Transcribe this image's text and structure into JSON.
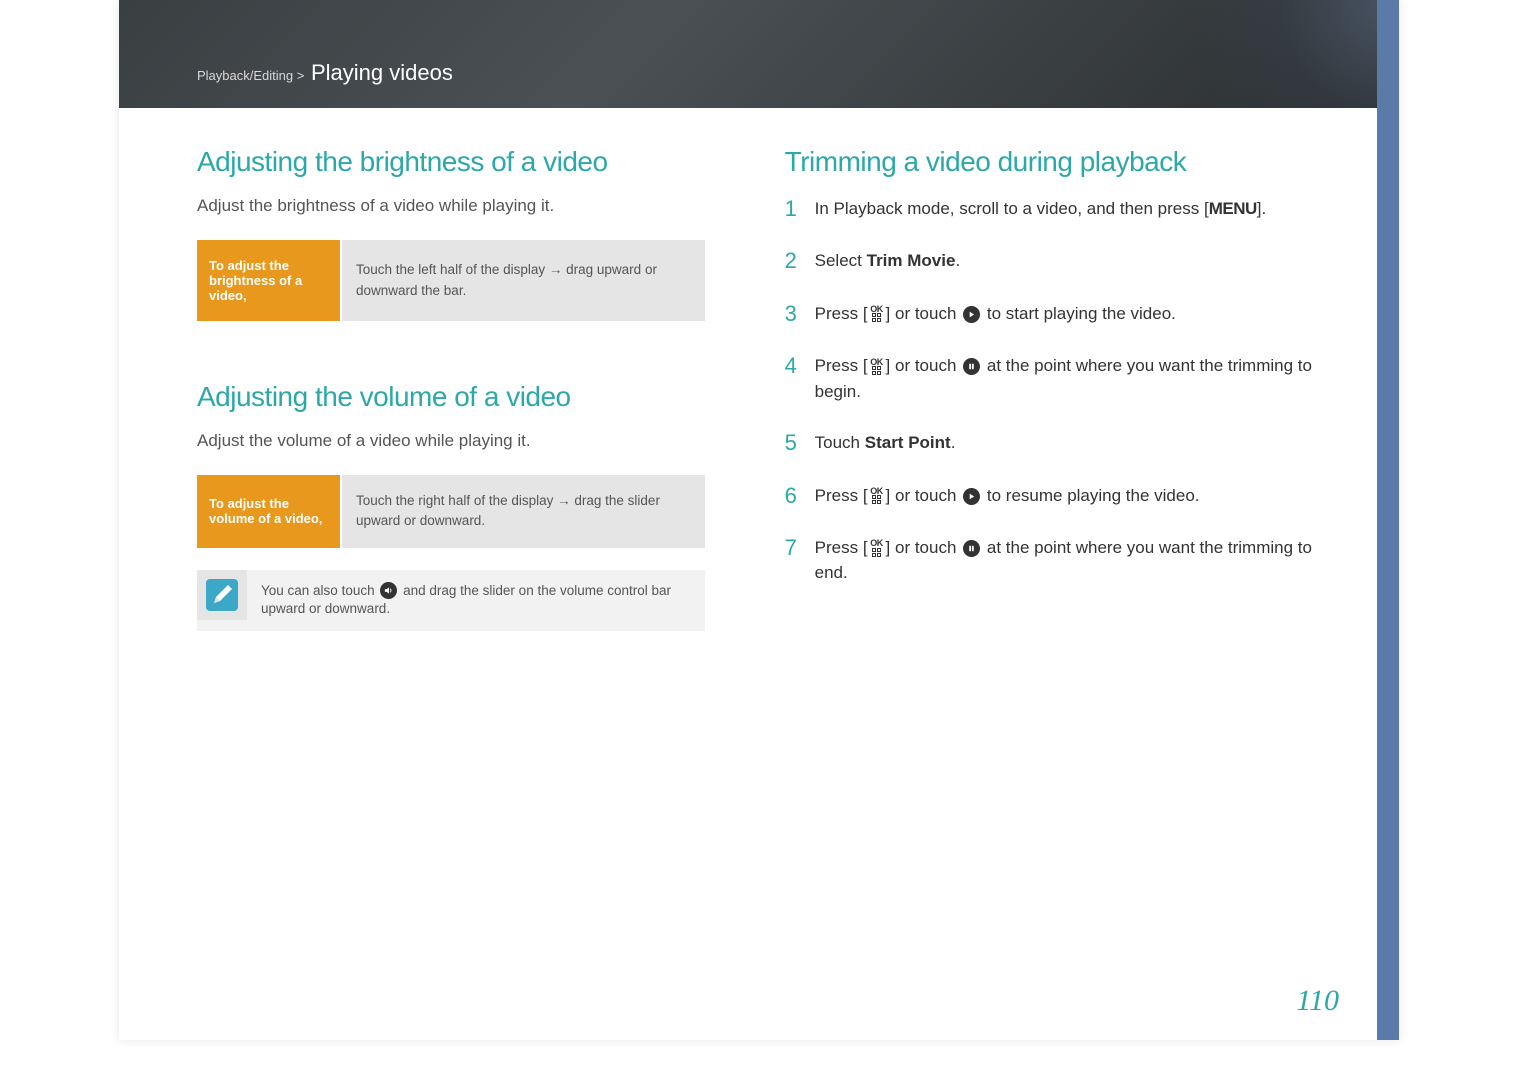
{
  "breadcrumb": {
    "category": "Playback/Editing",
    "separator": ">",
    "section": "Playing videos"
  },
  "left": {
    "brightness": {
      "title": "Adjusting the brightness of a video",
      "intro": "Adjust the brightness of a video while playing it.",
      "label": "To adjust the brightness of a video,",
      "value_pre": "Touch the left half of the display ",
      "value_post": " drag upward or downward the bar."
    },
    "volume": {
      "title": "Adjusting the volume of a video",
      "intro": "Adjust the volume of a video while playing it.",
      "label": "To adjust the volume of a video,",
      "value_pre": "Touch the right half of the display ",
      "value_post": " drag the slider upward or downward.",
      "note_pre": "You can also touch ",
      "note_post": " and drag the slider on the volume control bar upward or downward."
    }
  },
  "right": {
    "title": "Trimming a video during playback",
    "steps": {
      "s1": {
        "num": "1",
        "pre": "In Playback mode, scroll to a video, and then press [",
        "post": "]."
      },
      "s2": {
        "num": "2",
        "pre": "Select ",
        "bold": "Trim Movie",
        "post": "."
      },
      "s3": {
        "num": "3",
        "pre": "Press [",
        "mid": "] or touch ",
        "post": " to start playing the video."
      },
      "s4": {
        "num": "4",
        "pre": "Press [",
        "mid": "] or touch ",
        "post": " at the point where you want the trimming to begin."
      },
      "s5": {
        "num": "5",
        "pre": "Touch ",
        "bold": "Start Point",
        "post": "."
      },
      "s6": {
        "num": "6",
        "pre": "Press [",
        "mid": "] or touch ",
        "post": " to resume playing the video."
      },
      "s7": {
        "num": "7",
        "pre": "Press [",
        "mid": "] or touch ",
        "post": " at the point where you want the trimming to end."
      }
    }
  },
  "page_number": "110",
  "glyphs": {
    "arrow": "→",
    "menu": "MENU"
  }
}
